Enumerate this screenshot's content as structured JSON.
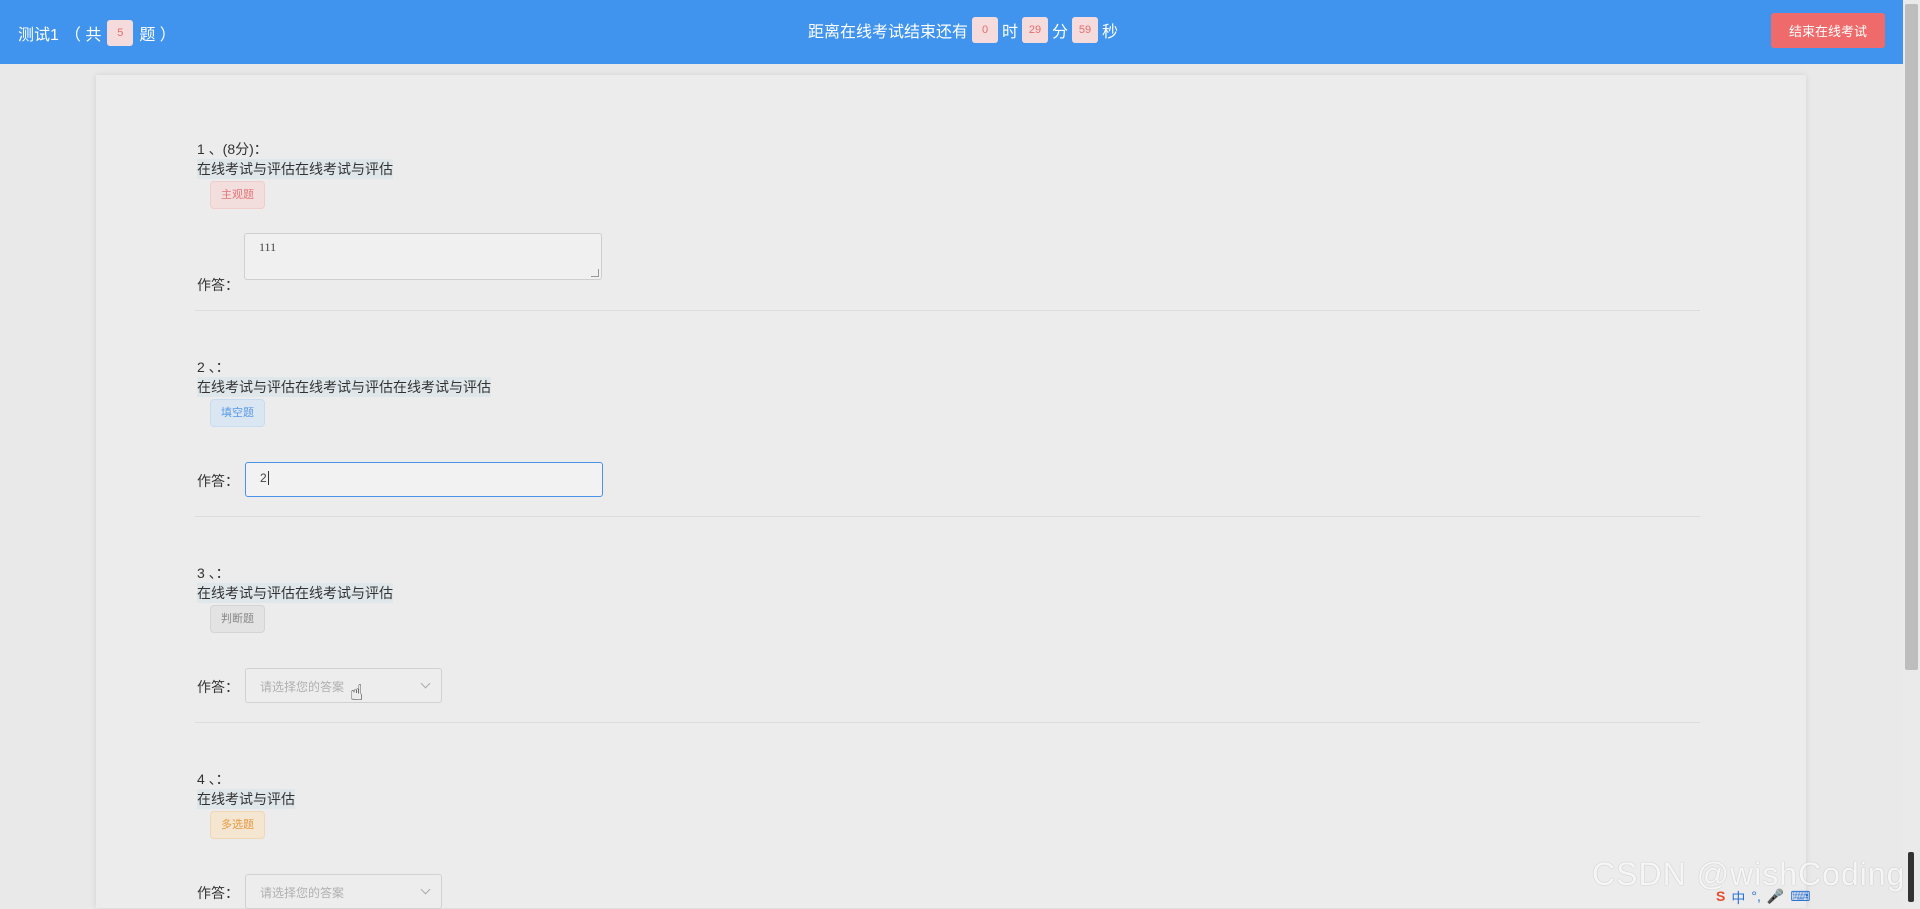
{
  "header": {
    "exam_name": "测试1",
    "count_open": "（ 共",
    "count": "5",
    "count_close": "题 ）",
    "timer_prefix": "距离在线考试结束还有",
    "hours": "0",
    "hours_unit": "时",
    "minutes": "29",
    "minutes_unit": "分",
    "seconds": "59",
    "seconds_unit": "秒",
    "end_button": "结束在线考试"
  },
  "answer_label": "作答：",
  "questions": [
    {
      "number": "1 、(8分)：",
      "text": "在线考试与评估在线考试与评估",
      "type": "主观题",
      "answer": "111"
    },
    {
      "number": "2 、：",
      "text": "在线考试与评估在线考试与评估在线考试与评估",
      "type": "填空题",
      "answer": "2"
    },
    {
      "number": "3 、：",
      "text": "在线考试与评估在线考试与评估",
      "type": "判断题",
      "placeholder": "请选择您的答案"
    },
    {
      "number": "4 、：",
      "text": "在线考试与评估",
      "type": "多选题",
      "placeholder": "请选择您的答案"
    }
  ],
  "watermark": "CSDN @wishCoding",
  "tray": {
    "ime": "中",
    "punct": "°,"
  }
}
